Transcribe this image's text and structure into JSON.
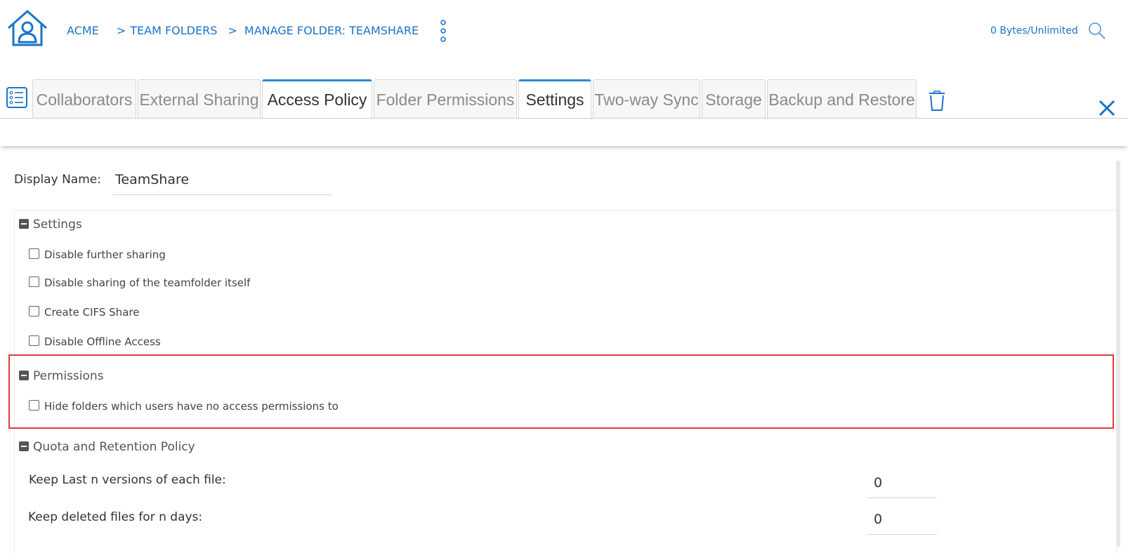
{
  "header": {
    "breadcrumb": {
      "root": "ACME",
      "sep1": ">",
      "item1": "TEAM FOLDERS",
      "sep2": ">",
      "item2": "MANAGE FOLDER: TEAMSHARE"
    },
    "quota": "0 Bytes/Unlimited"
  },
  "tabs": [
    {
      "label": "Collaborators",
      "active": false
    },
    {
      "label": "External Sharing",
      "active": false
    },
    {
      "label": "Access Policy",
      "active": true
    },
    {
      "label": "Folder Permissions",
      "active": false
    },
    {
      "label": "Settings",
      "active": true
    },
    {
      "label": "Two-way Sync",
      "active": false
    },
    {
      "label": "Storage",
      "active": false
    },
    {
      "label": "Backup and Restore",
      "active": false
    }
  ],
  "form": {
    "display_name_label": "Display Name:",
    "display_name_value": "TeamShare"
  },
  "sections": {
    "settings": {
      "title": "Settings",
      "options": [
        {
          "label": "Disable further sharing",
          "checked": false
        },
        {
          "label": "Disable sharing of the teamfolder itself",
          "checked": false
        },
        {
          "label": "Create CIFS Share",
          "checked": false
        },
        {
          "label": "Disable Offline Access",
          "checked": false
        }
      ]
    },
    "permissions": {
      "title": "Permissions",
      "options": [
        {
          "label": "Hide folders which users have no access permissions to",
          "checked": false
        }
      ]
    },
    "quota": {
      "title": "Quota and Retention Policy",
      "keep_versions_label": "Keep Last n versions of each file:",
      "keep_versions_value": "0",
      "keep_deleted_label": "Keep deleted files for n days:",
      "keep_deleted_value": "0"
    }
  },
  "colors": {
    "link": "#1a73c8",
    "active_tab_border": "#2a8ad4",
    "highlight": "#e03c3c"
  },
  "icons": [
    "home-icon",
    "kebab-menu-icon",
    "search-icon",
    "list-icon",
    "trash-icon",
    "close-icon",
    "minus-icon",
    "checkbox"
  ]
}
